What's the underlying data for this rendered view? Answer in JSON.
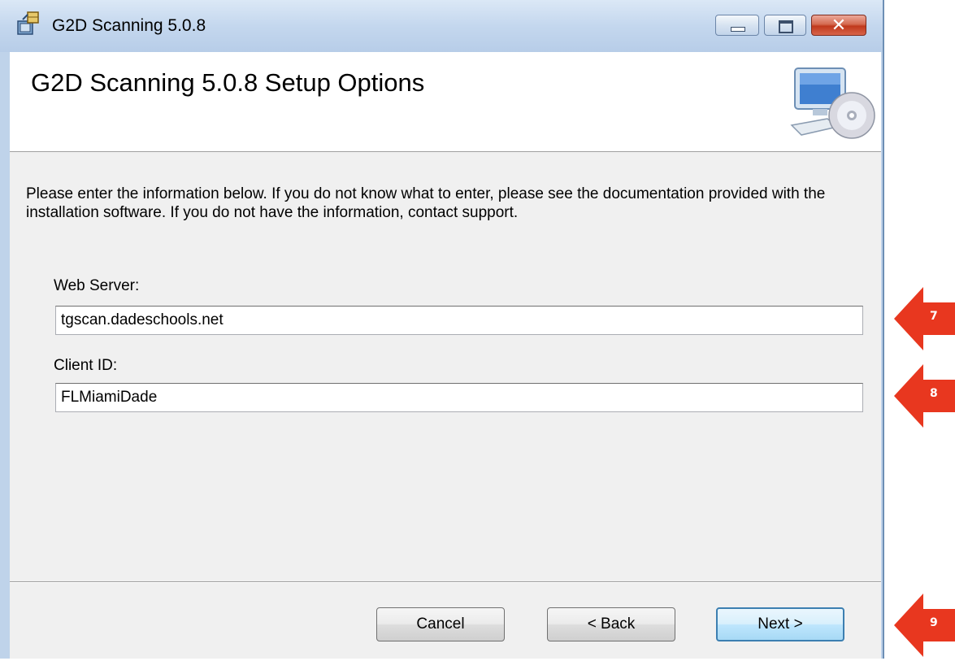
{
  "window": {
    "title": "G2D Scanning 5.0.8"
  },
  "banner": {
    "title": "G2D Scanning 5.0.8 Setup Options"
  },
  "instructions": "Please enter the information below. If you do not know what to enter, please see the documentation provided with the installation software. If you do not have the information, contact support.",
  "fields": {
    "web_server": {
      "label": "Web Server:",
      "value": "tgscan.dadeschools.net"
    },
    "client_id": {
      "label": "Client ID:",
      "value": "FLMiamiDade"
    }
  },
  "buttons": {
    "cancel": "Cancel",
    "back": "< Back",
    "next": "Next >"
  },
  "annotations": [
    {
      "number": "7",
      "color": "#e8371f"
    },
    {
      "number": "8",
      "color": "#e8371f"
    },
    {
      "number": "9",
      "color": "#e8371f"
    }
  ],
  "icons": {
    "app": "installer-package-icon",
    "setup": "computer-cd-icon",
    "minimize": "minimize-icon",
    "maximize": "maximize-icon",
    "close": "close-icon"
  }
}
